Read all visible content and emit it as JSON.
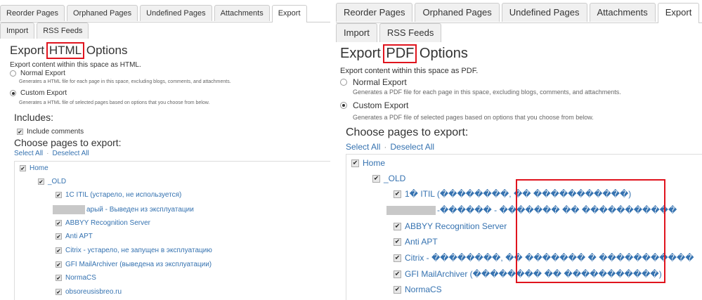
{
  "left": {
    "tabs": [
      "Reorder Pages",
      "Orphaned Pages",
      "Undefined Pages",
      "Attachments",
      "Export",
      "Import",
      "RSS Feeds"
    ],
    "active_tab": "Export",
    "title_pre": "Export ",
    "title_hl": "HTML",
    "title_post": " Options",
    "desc": "Export content within this space as HTML.",
    "normal_export": {
      "label": "Normal Export",
      "sub": "Generates a HTML file for each page in this space, excluding blogs, comments, and attachments.",
      "selected": false
    },
    "custom_export": {
      "label": "Custom Export",
      "sub": "Generates a HTML file of selected pages based on options that you choose from below.",
      "selected": true
    },
    "includes_heading": "Includes:",
    "include_comments": "Include comments",
    "choose_heading": "Choose pages to export:",
    "select_all": "Select All",
    "sep": "·",
    "deselect_all": "Deselect All",
    "pages": [
      {
        "text": "Home",
        "level": 0
      },
      {
        "text": "_OLD",
        "level": 1
      },
      {
        "text": "1C ITIL (устарело, не используется)",
        "level": 2
      },
      {
        "text": "арый - Выведен из эксплуатации",
        "level": 2,
        "redacted": true
      },
      {
        "text": "ABBYY Recognition Server",
        "level": 2
      },
      {
        "text": "Anti APT",
        "level": 2
      },
      {
        "text": "Citrix - устарело, не запущен в эксплуатацию",
        "level": 2
      },
      {
        "text": "GFI MailArchiver (выведена из эксплуатации)",
        "level": 2
      },
      {
        "text": "NormaCS",
        "level": 2
      },
      {
        "text": "obsoreusisbreo.ru",
        "level": 2
      }
    ]
  },
  "right": {
    "tabs": [
      "Reorder Pages",
      "Orphaned Pages",
      "Undefined Pages",
      "Attachments",
      "Export",
      "Import",
      "RSS Feeds"
    ],
    "active_tab": "Export",
    "title_pre": "Export ",
    "title_hl": "PDF",
    "title_post": " Options",
    "desc": "Export content within this space as PDF.",
    "normal_export": {
      "label": "Normal Export",
      "sub": "Generates a PDF file for each page in this space, excluding blogs, comments, and attachments.",
      "selected": false
    },
    "custom_export": {
      "label": "Custom Export",
      "sub": "Generates a PDF file of selected pages based on options that you choose from below.",
      "selected": true
    },
    "choose_heading": "Choose pages to export:",
    "select_all": "Select All",
    "sep": "·",
    "deselect_all": "Deselect All",
    "pages": [
      {
        "text": "Home",
        "level": 0
      },
      {
        "text": "_OLD",
        "level": 1
      },
      {
        "text": "1� ITIL (��������, �� �����������)",
        "level": 2
      },
      {
        "text": "-������ - ������� �� �����������",
        "level": 2,
        "redacted": true
      },
      {
        "text": "ABBYY Recognition Server",
        "level": 2
      },
      {
        "text": "Anti APT",
        "level": 2
      },
      {
        "text": "Citrix - ��������, �� ������� � �����������",
        "level": 2
      },
      {
        "text": "GFI MailArchiver (�������� �� �����������)",
        "level": 2
      },
      {
        "text": "NormaCS",
        "level": 2
      }
    ]
  },
  "colors": {
    "link": "#3572b0",
    "highlight": "#e0141e",
    "text": "#333333"
  }
}
